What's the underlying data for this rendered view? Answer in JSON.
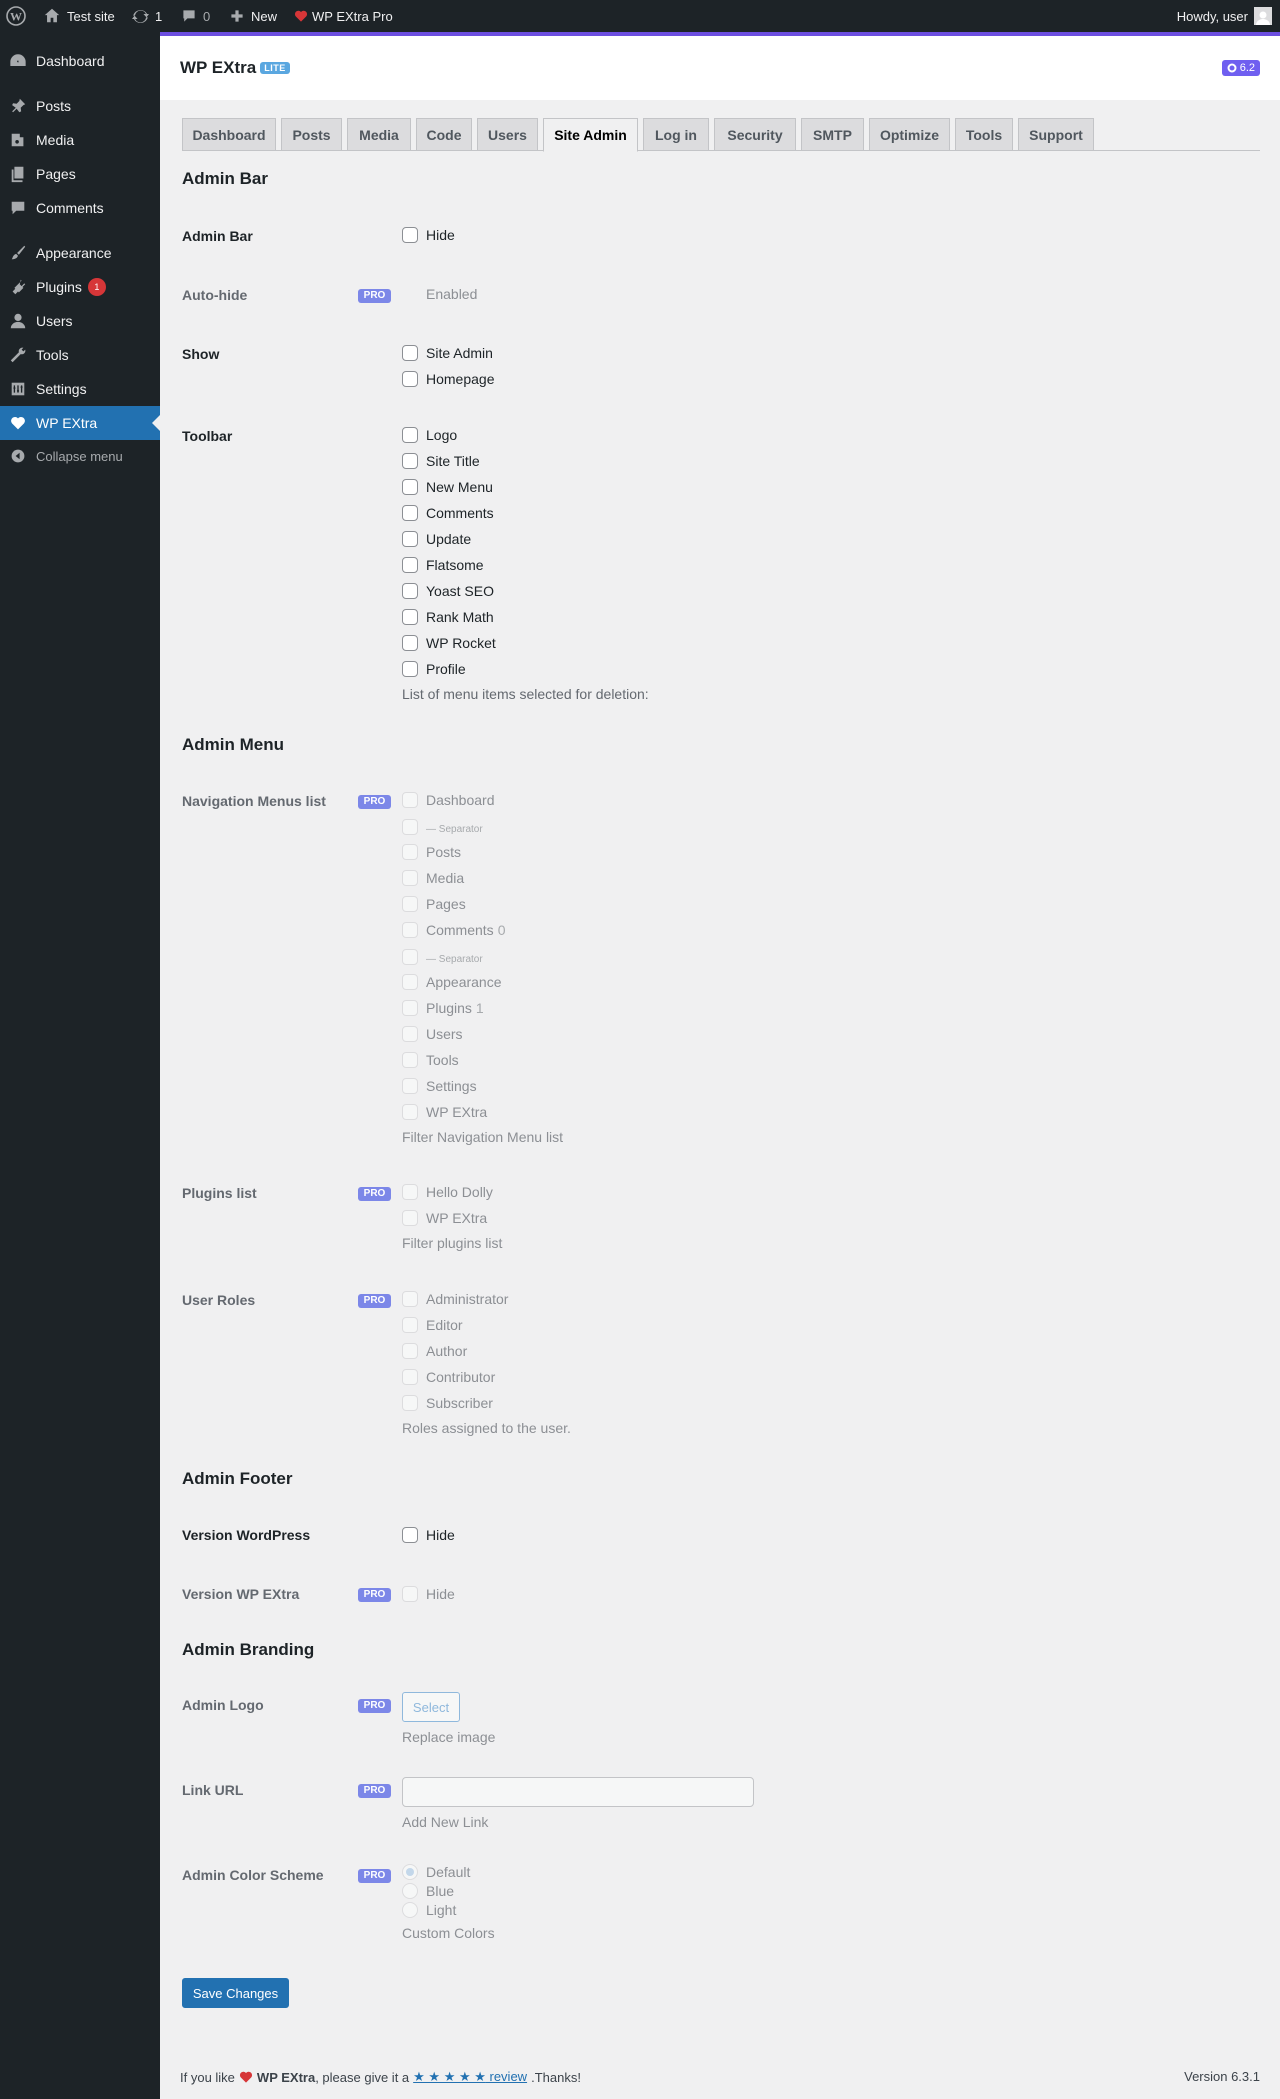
{
  "adminbar": {
    "site_name": "Test site",
    "updates_count": "1",
    "comments_count": "0",
    "new_label": "New",
    "pro_label": "WP EXtra Pro",
    "howdy": "Howdy, user"
  },
  "sidebar": {
    "items": [
      {
        "label": "Dashboard",
        "icon": "dashboard-icon"
      },
      {
        "label": "Posts",
        "icon": "pin-icon"
      },
      {
        "label": "Media",
        "icon": "media-icon"
      },
      {
        "label": "Pages",
        "icon": "pages-icon"
      },
      {
        "label": "Comments",
        "icon": "comment-icon"
      },
      {
        "label": "Appearance",
        "icon": "brush-icon"
      },
      {
        "label": "Plugins",
        "icon": "plugin-icon",
        "badge": "1"
      },
      {
        "label": "Users",
        "icon": "user-icon"
      },
      {
        "label": "Tools",
        "icon": "wrench-icon"
      },
      {
        "label": "Settings",
        "icon": "settings-icon"
      },
      {
        "label": "WP EXtra",
        "icon": "heart-icon"
      }
    ],
    "collapse_label": "Collapse menu"
  },
  "plugin": {
    "title": "WP EXtra",
    "lite_badge": "LITE",
    "version_badge": "6.2"
  },
  "tabs": [
    "Dashboard",
    "Posts",
    "Media",
    "Code",
    "Users",
    "Site Admin",
    "Log in",
    "Security",
    "SMTP",
    "Optimize",
    "Tools",
    "Support"
  ],
  "pro_badge": "PRO",
  "sections": {
    "admin_bar": {
      "heading": "Admin Bar",
      "admin_bar_label": "Admin Bar",
      "hide": "Hide",
      "autohide_label": "Auto-hide",
      "enabled": "Enabled",
      "show_label": "Show",
      "show_options": [
        "Site Admin",
        "Homepage"
      ],
      "toolbar_label": "Toolbar",
      "toolbar_options": [
        "Logo",
        "Site Title",
        "New Menu",
        "Comments",
        "Update",
        "Flatsome",
        "Yoast SEO",
        "Rank Math",
        "WP Rocket",
        "Profile"
      ],
      "toolbar_desc": "List of menu items selected for deletion:"
    },
    "admin_menu": {
      "heading": "Admin Menu",
      "nav_label": "Navigation Menus list",
      "nav_options": [
        "Dashboard",
        "— Separator",
        "Posts",
        "Media",
        "Pages",
        "Comments",
        "— Separator",
        "Appearance",
        "Plugins",
        "Users",
        "Tools",
        "Settings",
        "WP EXtra"
      ],
      "comments_count": "0",
      "plugins_count": "1",
      "nav_desc": "Filter Navigation Menu list",
      "plugins_label": "Plugins list",
      "plugins_options": [
        "Hello Dolly",
        "WP EXtra"
      ],
      "plugins_desc": "Filter plugins list",
      "roles_label": "User Roles",
      "roles_options": [
        "Administrator",
        "Editor",
        "Author",
        "Contributor",
        "Subscriber"
      ],
      "roles_desc": "Roles assigned to the user."
    },
    "admin_footer": {
      "heading": "Admin Footer",
      "version_wp_label": "Version WordPress",
      "version_extra_label": "Version WP EXtra",
      "hide": "Hide"
    },
    "branding": {
      "heading": "Admin Branding",
      "logo_label": "Admin Logo",
      "select_button": "Select",
      "logo_desc": "Replace image",
      "link_label": "Link URL",
      "link_value": "",
      "link_desc": "Add New Link",
      "scheme_label": "Admin Color Scheme",
      "scheme_options": [
        "Default",
        "Blue",
        "Light"
      ],
      "scheme_selected": "Default",
      "scheme_desc": "Custom Colors"
    }
  },
  "save_button": "Save Changes",
  "footer": {
    "prefix": "If you like",
    "brand": "WP EXtra",
    "middle": ", please give it a",
    "stars": "★ ★ ★ ★ ★",
    "review": "review",
    "suffix": ".Thanks!",
    "version": "Version 6.3.1"
  },
  "colors": {
    "accent": "#2271b1",
    "pro_badge": "#7c87e8",
    "header_border": "#6c4ee0",
    "heart": "#d63638"
  }
}
